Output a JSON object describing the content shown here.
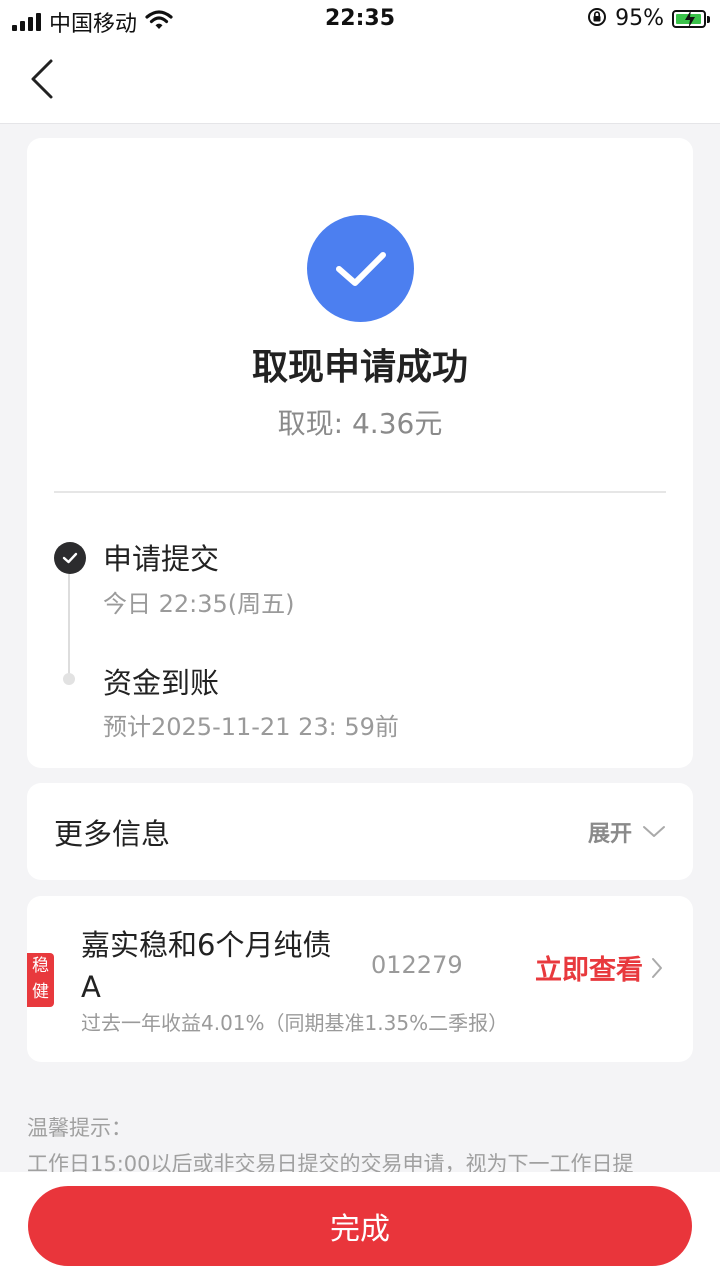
{
  "status_bar": {
    "carrier": "中国移动",
    "time": "22:35",
    "battery_percent": "95%",
    "battery_level": 0.95
  },
  "nav": {
    "back_icon": "chevron-left-icon"
  },
  "result": {
    "icon": "check-icon",
    "accent_color": "#4c7ff0",
    "title": "取现申请成功",
    "amount": "取现: 4.36元"
  },
  "timeline": [
    {
      "title": "申请提交",
      "subtitle": "今日 22:35(周五)",
      "status": "done"
    },
    {
      "title": "资金到账",
      "subtitle": "预计2025-11-21 23: 59前",
      "status": "pending"
    }
  ],
  "more_info": {
    "label": "更多信息",
    "toggle_label": "展开"
  },
  "fund": {
    "tag": "稳健",
    "name": "嘉实稳和6个月纯债A",
    "code": "012279",
    "action_label": "立即查看",
    "yield_text": "过去一年收益4.01%（同期基准1.35%二季报）",
    "accent_color": "#e8393d"
  },
  "tips": {
    "title": "温馨提示：",
    "body": "工作日15:00以后或非交易日提交的交易申请，视为下一工作日提"
  },
  "footer": {
    "done_label": "完成"
  }
}
